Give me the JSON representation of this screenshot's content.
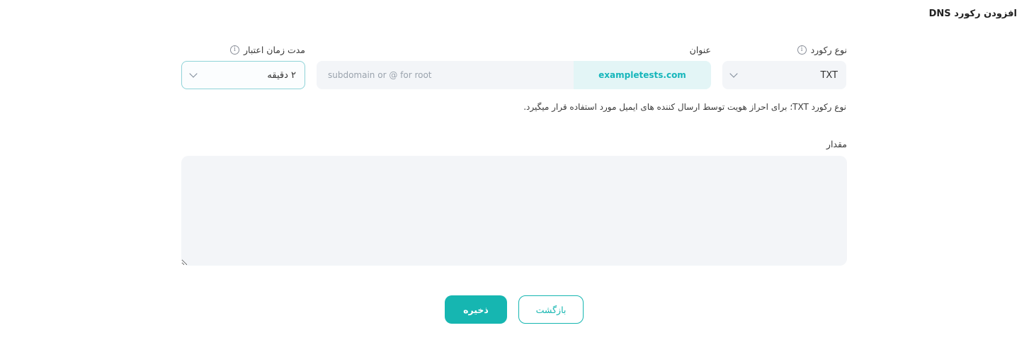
{
  "page": {
    "title": "افزودن رکورد DNS"
  },
  "record_type": {
    "label": "نوع رکورد",
    "info_icon": "info-icon",
    "selected": "TXT"
  },
  "record_name": {
    "label": "عنوان",
    "placeholder": "subdomain or @ for root",
    "value": "",
    "domain_suffix": "exampletests.com"
  },
  "ttl": {
    "label": "مدت زمان اعتبار",
    "info_icon": "info-icon",
    "selected": "۲ دقیقه"
  },
  "help_text": "نوع رکورد TXT؛ برای احراز هویت توسط ارسال کننده های ایمیل مورد استفاده قرار میگیرد.",
  "value_field": {
    "label": "مقدار",
    "value": ""
  },
  "buttons": {
    "save": "ذخیره",
    "back": "بازگشت"
  },
  "colors": {
    "accent": "#16b6b1",
    "input_bg": "#f3f5f8",
    "suffix_bg": "#e3f5f6"
  }
}
